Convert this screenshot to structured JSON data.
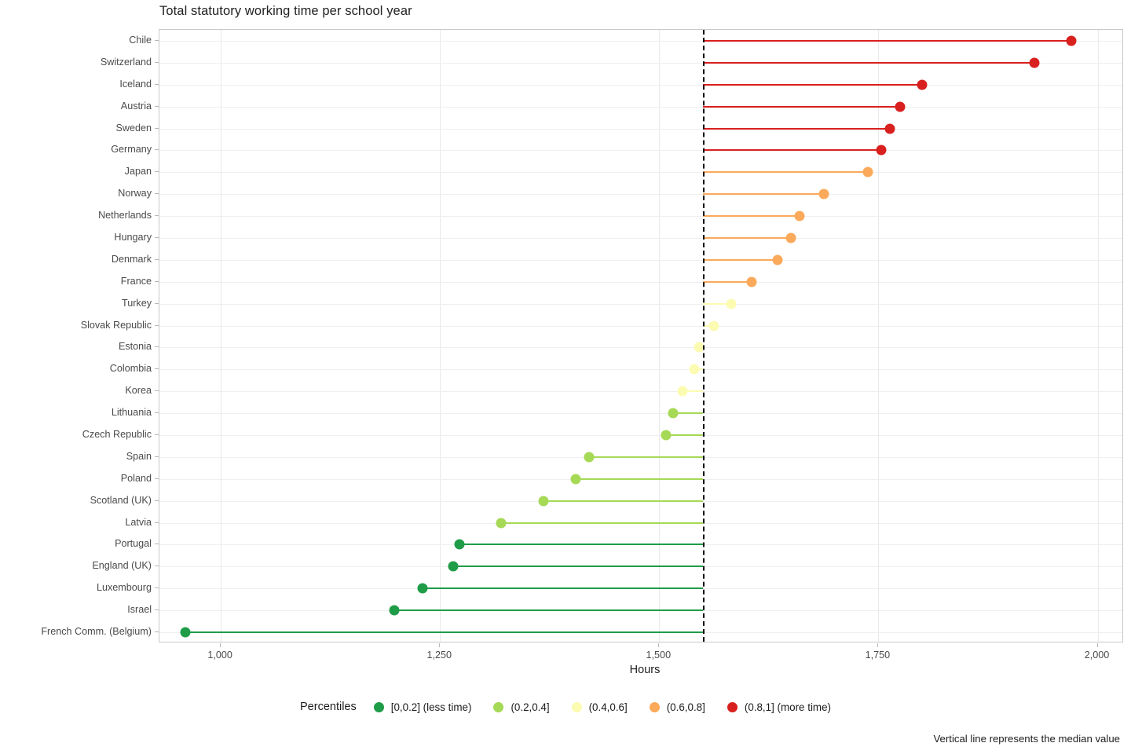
{
  "chart_data": {
    "type": "bar",
    "title": "Total statutory working time per school year",
    "xlabel": "Hours",
    "ylabel": "",
    "xlim": [
      930,
      2030
    ],
    "xticks": [
      1000,
      1250,
      1500,
      1750,
      2000
    ],
    "xtick_labels": [
      "1,000",
      "1,250",
      "1,500",
      "1,750",
      "2,000"
    ],
    "grid": true,
    "orientation": "horizontal",
    "baseline": 1550,
    "median_value": 1550,
    "median_note": "Vertical line represents the median value",
    "legend_title": "Percentiles",
    "legend_position": "bottom",
    "categories": [
      "Chile",
      "Switzerland",
      "Iceland",
      "Austria",
      "Sweden",
      "Germany",
      "Japan",
      "Norway",
      "Netherlands",
      "Hungary",
      "Denmark",
      "France",
      "Turkey",
      "Slovak Republic",
      "Estonia",
      "Colombia",
      "Korea",
      "Lithuania",
      "Czech Republic",
      "Spain",
      "Poland",
      "Scotland (UK)",
      "Latvia",
      "Portugal",
      "England (UK)",
      "Luxembourg",
      "Israel",
      "French Comm. (Belgium)"
    ],
    "values": [
      1970,
      1928,
      1800,
      1775,
      1763,
      1753,
      1738,
      1688,
      1660,
      1650,
      1635,
      1605,
      1582,
      1562,
      1545,
      1540,
      1527,
      1516,
      1508,
      1420,
      1405,
      1368,
      1320,
      1272,
      1265,
      1230,
      1198,
      960
    ],
    "point_percentiles": [
      "(0.8,1]",
      "(0.8,1]",
      "(0.8,1]",
      "(0.8,1]",
      "(0.8,1]",
      "(0.8,1]",
      "(0.6,0.8]",
      "(0.6,0.8]",
      "(0.6,0.8]",
      "(0.6,0.8]",
      "(0.6,0.8]",
      "(0.6,0.8]",
      "(0.4,0.6]",
      "(0.4,0.6]",
      "(0.4,0.6]",
      "(0.4,0.6]",
      "(0.4,0.6]",
      "(0.2,0.4]",
      "(0.2,0.4]",
      "(0.2,0.4]",
      "(0.2,0.4]",
      "(0.2,0.4]",
      "(0.2,0.4]",
      "[0,0.2]",
      "[0,0.2]",
      "[0,0.2]",
      "[0,0.2]",
      "[0,0.2]"
    ],
    "legend_entries": [
      {
        "label": "[0,0.2] (less time)",
        "key": "[0,0.2]",
        "color": "#1f9c48"
      },
      {
        "label": "(0.2,0.4]",
        "key": "(0.2,0.4]",
        "color": "#a6d956"
      },
      {
        "label": "(0.4,0.6]",
        "key": "(0.4,0.6]",
        "color": "#fbfbb2"
      },
      {
        "label": "(0.6,0.8]",
        "key": "(0.6,0.8]",
        "color": "#fba95a"
      },
      {
        "label": "(0.8,1]  (more time)",
        "key": "(0.8,1]",
        "color": "#d8201f"
      }
    ]
  },
  "colors": {
    "p0": "#1f9c48",
    "p20": "#a6d956",
    "p40": "#fbfbb2",
    "p60": "#fba95a",
    "p80": "#d8201f",
    "grid": "#ececec",
    "panel_border": "#c9c9c9",
    "median_line": "#111111",
    "axis_text": "#4a4a4a",
    "title_text": "#222222"
  }
}
